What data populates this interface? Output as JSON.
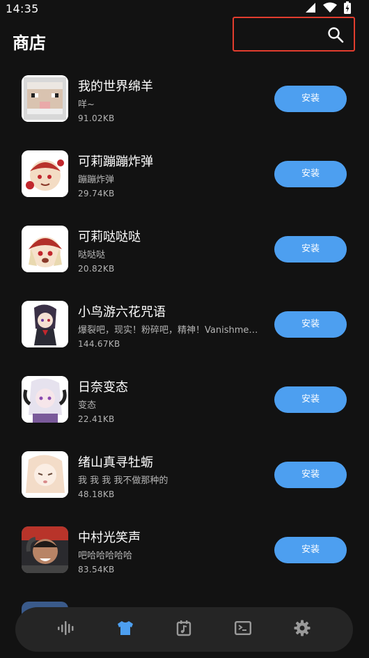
{
  "status_bar": {
    "time": "14:35"
  },
  "header": {
    "title": "商店",
    "search_placeholder": ""
  },
  "apps": [
    {
      "name": "我的世界绵羊",
      "desc": "咩~",
      "size": "91.02KB",
      "install_label": "安装"
    },
    {
      "name": "可莉蹦蹦炸弹",
      "desc": "蹦蹦炸弹",
      "size": "29.74KB",
      "install_label": "安装"
    },
    {
      "name": "可莉哒哒哒",
      "desc": "哒哒哒",
      "size": "20.82KB",
      "install_label": "安装"
    },
    {
      "name": "小鸟游六花咒语",
      "desc": "爆裂吧，现实！粉碎吧，精神！Vanishment This World！",
      "size": "144.67KB",
      "install_label": "安装"
    },
    {
      "name": "日奈变态",
      "desc": "变态",
      "size": "22.41KB",
      "install_label": "安装"
    },
    {
      "name": "绪山真寻牡蛎",
      "desc": "我 我 我 我不做那种的",
      "size": "48.18KB",
      "install_label": "安装"
    },
    {
      "name": "中村光笑声",
      "desc": "吧哈哈哈哈哈",
      "size": "83.54KB",
      "install_label": "安装"
    }
  ],
  "bottom_nav": {
    "items": [
      {
        "icon": "audio-wave-icon",
        "active": false
      },
      {
        "icon": "shirt-icon",
        "active": true
      },
      {
        "icon": "music-calendar-icon",
        "active": false
      },
      {
        "icon": "terminal-icon",
        "active": false
      },
      {
        "icon": "gear-icon",
        "active": false
      }
    ],
    "active_color": "#4d9ff0",
    "inactive_color": "#9a9a9a"
  },
  "colors": {
    "background": "#121212",
    "accent": "#4d9ff0",
    "highlight_border": "#e23d2e"
  }
}
